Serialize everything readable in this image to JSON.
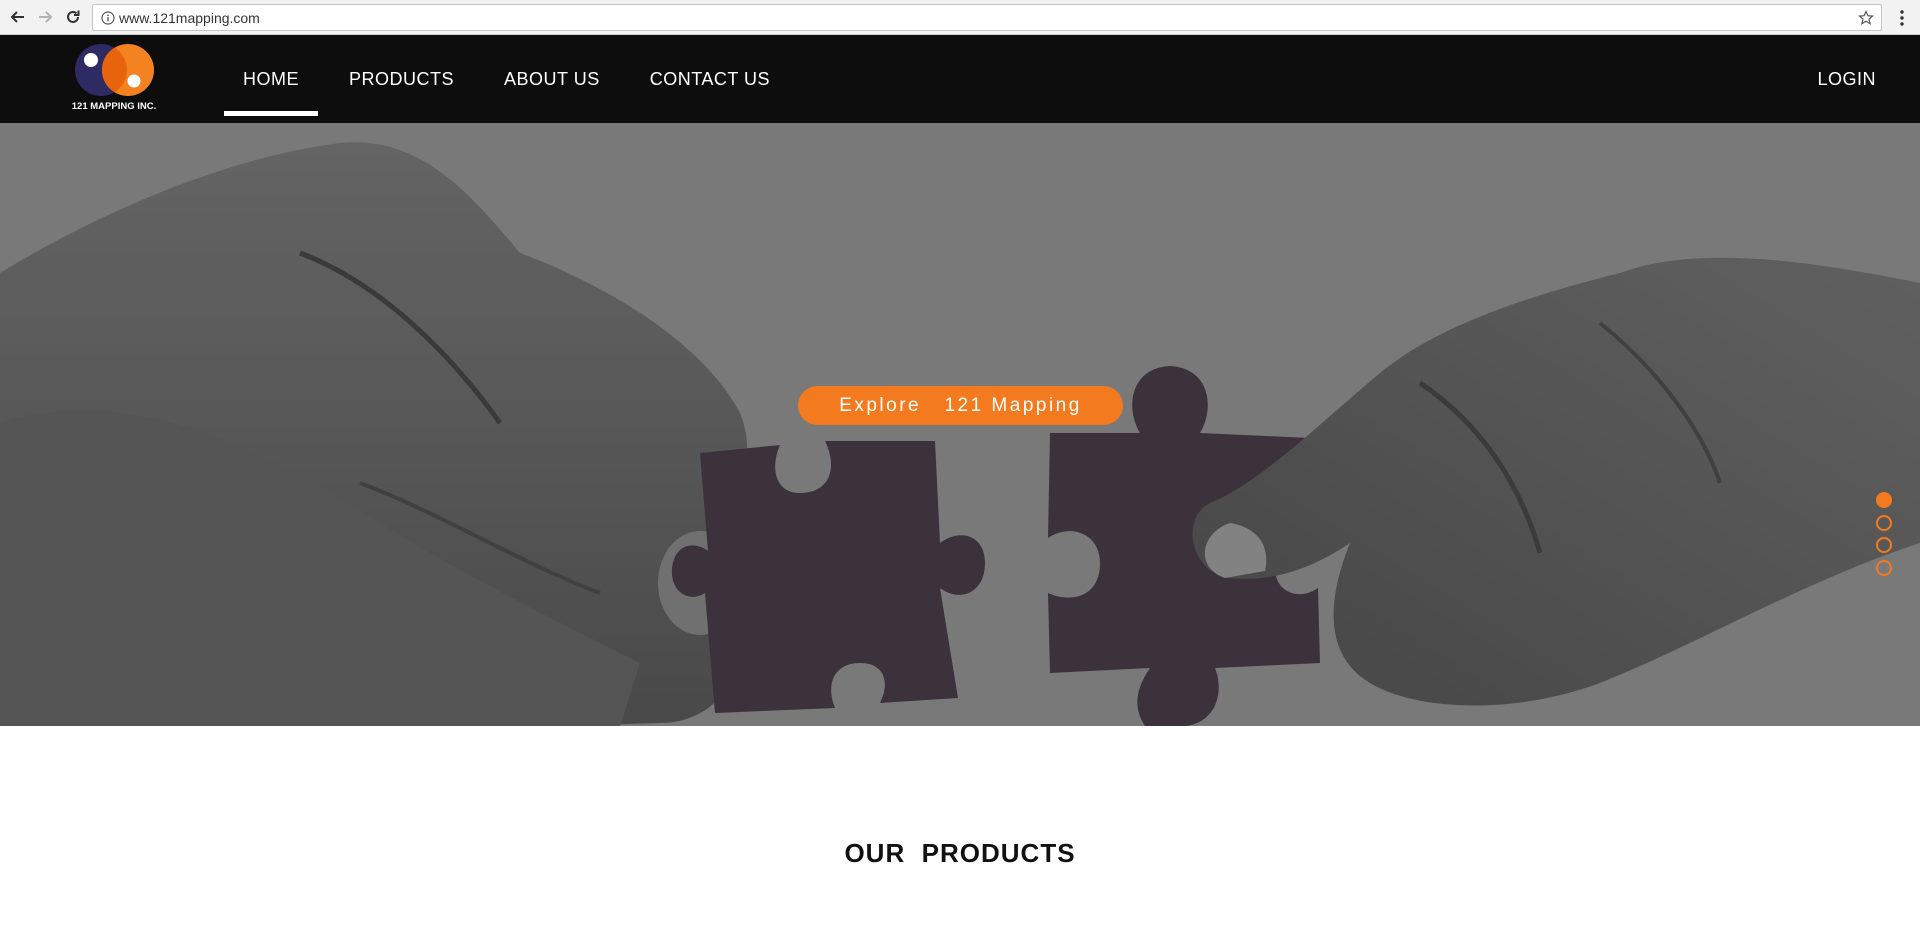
{
  "browser": {
    "url": "www.121mapping.com",
    "icons": {
      "back": "arrow-left-icon",
      "forward": "arrow-right-icon",
      "reload": "reload-icon",
      "info": "info-icon",
      "bookmark": "star-icon",
      "menu": "vertical-dots-icon"
    }
  },
  "header": {
    "logo_text": "121 MAPPING INC.",
    "nav": [
      {
        "label": "HOME",
        "active": true
      },
      {
        "label": "PRODUCTS",
        "active": false
      },
      {
        "label": "ABOUT US",
        "active": false
      },
      {
        "label": "CONTACT US",
        "active": false
      }
    ],
    "login_label": "LOGIN"
  },
  "hero": {
    "cta_label": "Explore   121 Mapping",
    "slides": {
      "count": 4,
      "active_index": 0
    }
  },
  "products": {
    "heading": "OUR  PRODUCTS"
  },
  "colors": {
    "accent": "#f47a1f",
    "header_bg": "#0d0d0d",
    "hero_bg": "#808080",
    "logo_navy": "#2e2a63",
    "logo_orange": "#f58220",
    "puzzle": "#3f353f"
  }
}
